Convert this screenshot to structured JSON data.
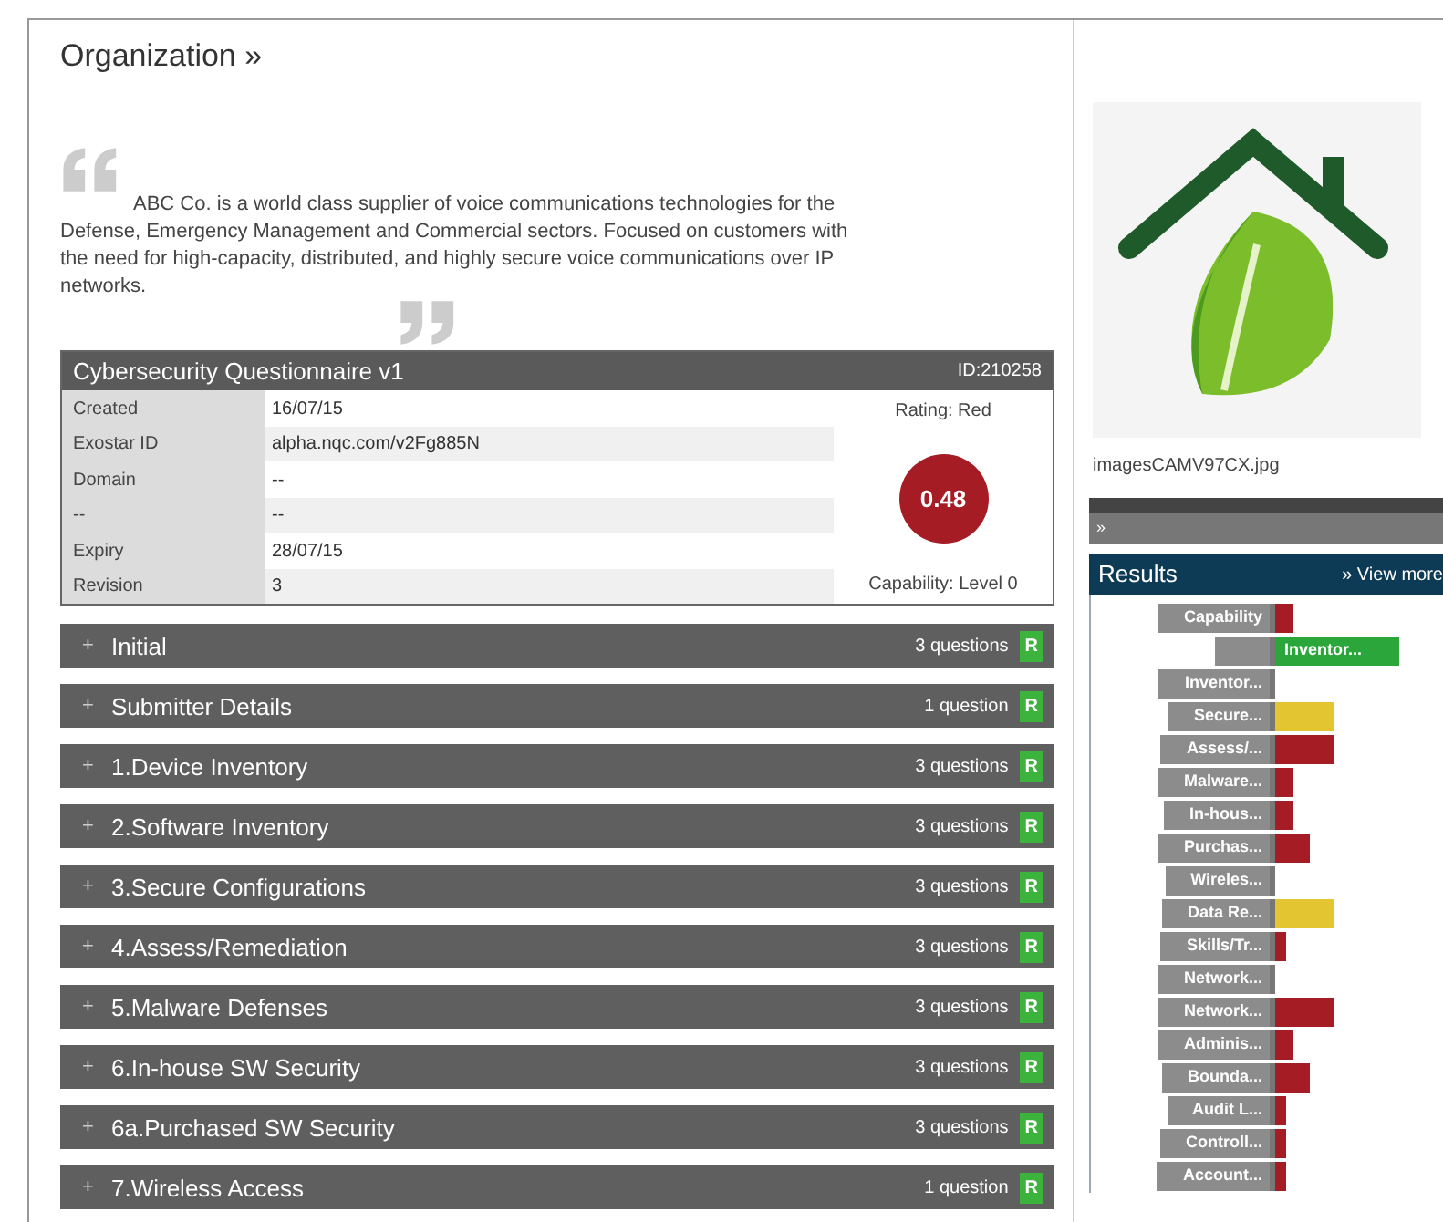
{
  "page_title": "Organization »",
  "description": "ABC Co. is a world class supplier of voice communications technologies for the Defense, Emergency Management and Commercial sectors. Focused on customers with the need for high-capacity, distributed, and highly secure voice communications over IP networks.",
  "questionnaire": {
    "title": "Cybersecurity Questionnaire v1",
    "id": "ID:210258",
    "fields": [
      {
        "label": "Created",
        "value": "16/07/15"
      },
      {
        "label": "Exostar ID",
        "value": "alpha.nqc.com/v2Fg885N"
      },
      {
        "label": "Domain",
        "value": "--"
      },
      {
        "label": "--",
        "value": "--"
      },
      {
        "label": "Expiry",
        "value": "28/07/15"
      },
      {
        "label": "Revision",
        "value": "3"
      }
    ],
    "rating": "Rating: Red",
    "score": "0.48",
    "capability": "Capability: Level 0"
  },
  "sections": [
    {
      "expander": "+",
      "title": "Initial",
      "count": "3 questions",
      "badge": "R"
    },
    {
      "expander": "+",
      "title": "Submitter Details",
      "count": "1 question",
      "badge": "R"
    },
    {
      "expander": "+",
      "title": "1.Device Inventory",
      "count": "3 questions",
      "badge": "R"
    },
    {
      "expander": "+",
      "title": "2.Software Inventory",
      "count": "3 questions",
      "badge": "R"
    },
    {
      "expander": "+",
      "title": "3.Secure Configurations",
      "count": "3 questions",
      "badge": "R"
    },
    {
      "expander": "+",
      "title": "4.Assess/Remediation",
      "count": "3 questions",
      "badge": "R"
    },
    {
      "expander": "+",
      "title": "5.Malware Defenses",
      "count": "3 questions",
      "badge": "R"
    },
    {
      "expander": "+",
      "title": "6.In-house SW Security",
      "count": "3 questions",
      "badge": "R"
    },
    {
      "expander": "+",
      "title": "6a.Purchased SW Security",
      "count": "3 questions",
      "badge": "R"
    },
    {
      "expander": "+",
      "title": "7.Wireless Access",
      "count": "1 question",
      "badge": "R"
    }
  ],
  "image_panel": {
    "kind": "picture",
    "caption": "imagesCAMV97CX.jpg",
    "bar_text": "»"
  },
  "results": {
    "title": "Results",
    "link": "» View more",
    "rows": [
      {
        "kind": "small",
        "label": "Capability",
        "color": "#a51c24"
      },
      {
        "kind": "full",
        "label": "Inventor...",
        "color": "#2aa63a"
      },
      {
        "kind": "empty",
        "label": "Inventor..."
      },
      {
        "kind": "large",
        "label": "Secure...",
        "color": "#e3c532"
      },
      {
        "kind": "large",
        "label": "Assess/...",
        "color": "#a51c24"
      },
      {
        "kind": "small",
        "label": "Malware...",
        "color": "#a51c24"
      },
      {
        "kind": "small",
        "label": "In-hous...",
        "color": "#a51c24"
      },
      {
        "kind": "medium",
        "label": "Purchas...",
        "color": "#a51c24"
      },
      {
        "kind": "empty",
        "label": "Wireles..."
      },
      {
        "kind": "large",
        "label": "Data Re...",
        "color": "#e3c532"
      },
      {
        "kind": "tiny",
        "label": "Skills/Tr...",
        "color": "#a51c24"
      },
      {
        "kind": "empty",
        "label": "Network..."
      },
      {
        "kind": "large",
        "label": "Network...",
        "color": "#a51c24"
      },
      {
        "kind": "small",
        "label": "Adminis...",
        "color": "#a51c24"
      },
      {
        "kind": "medium",
        "label": "Bounda...",
        "color": "#a51c24"
      },
      {
        "kind": "tiny",
        "label": "Audit L...",
        "color": "#a51c24"
      },
      {
        "kind": "tiny",
        "label": "Controll...",
        "color": "#a51c24"
      },
      {
        "kind": "tiny",
        "label": "Account...",
        "color": "#a51c24"
      }
    ]
  }
}
